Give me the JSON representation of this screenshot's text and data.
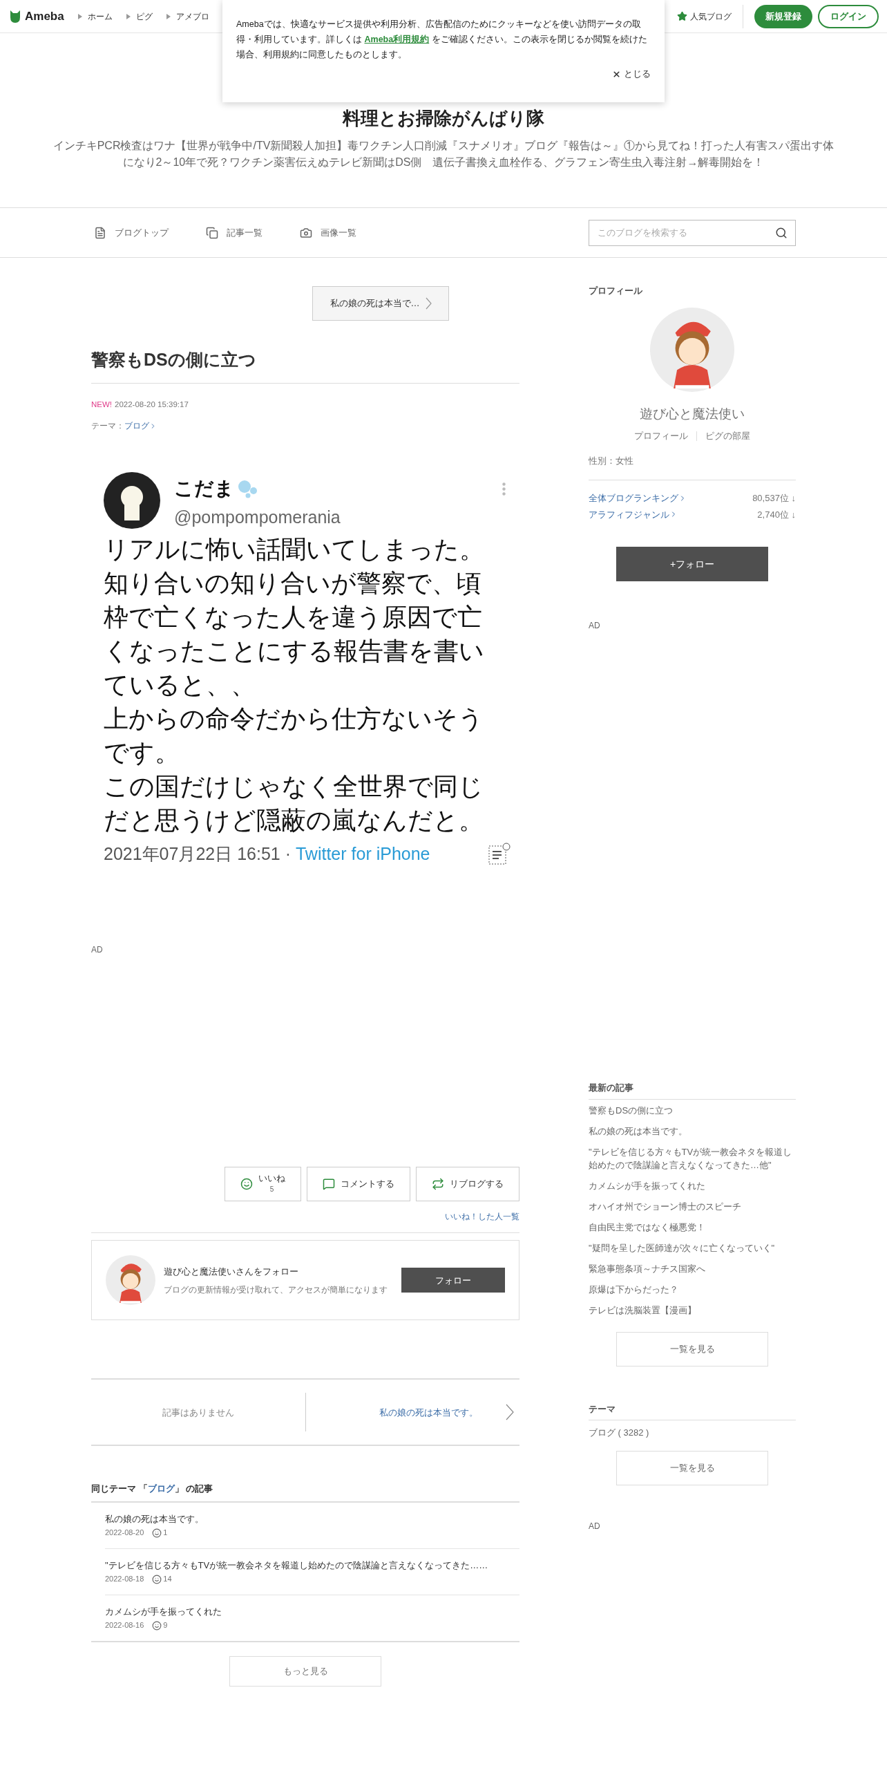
{
  "header": {
    "logo": "Ameba",
    "nav": [
      "ホーム",
      "ピグ",
      "アメブロ"
    ],
    "popular": "人気ブログ",
    "signup": "新規登録",
    "login": "ログイン"
  },
  "cookie_banner": {
    "text_before": "Amebaでは、快適なサービス提供や利用分析、広告配信のためにクッキーなどを使い訪問データの取得・利用しています。詳しくは ",
    "link": "Ameba利用規約",
    "text_after": " をご確認ください。この表示を閉じるか閲覧を続けた場合、利用規約に同意したものとします。",
    "close": "とじる"
  },
  "blog": {
    "title": "料理とお掃除がんばり隊",
    "description": "インチキPCR検査はワナ【世界が戦争中/TV新聞殺人加担】毒ワクチン人口削減『スナメリオ』ブログ『報告は～』①から見てね！打った人有害スパ蛋出す体になり2～10年で死？ワクチン薬害伝えぬテレビ新聞はDS側　遺伝子書換え血栓作る、グラフェン寄生虫入毒注射→解毒開始を！"
  },
  "blog_nav": [
    {
      "kind": "doc",
      "label": "ブログトップ"
    },
    {
      "kind": "pages",
      "label": "記事一覧"
    },
    {
      "kind": "camera",
      "label": "画像一覧"
    }
  ],
  "search": {
    "placeholder": "このブログを検索する"
  },
  "article": {
    "prev_link": "私の娘の死は本当で…",
    "title": "警察もDSの側に立つ",
    "new_badge": "NEW!",
    "date": "2022-08-20 15:39:17",
    "theme_label": "テーマ：",
    "theme": "ブログ",
    "tweet": {
      "name": "こだま",
      "handle": "@pompompomerania",
      "lines": [
        "リアルに怖い話聞いてしまった。",
        "知り合いの知り合いが警察で、頃枠で亡くなった人を違う原因で亡くなったことにする報告書を書いていると、、",
        "上からの命令だから仕方ないそうです。",
        "この国だけじゃなく全世界で同じだと思うけど隠蔽の嵐なんだと。"
      ],
      "date": "2021年07月22日 16:51 · ",
      "source": "Twitter for iPhone"
    },
    "ad": "AD",
    "actions": [
      {
        "kind": "like",
        "label": "いいね",
        "count": "5"
      },
      {
        "kind": "comment",
        "label": "コメントする"
      },
      {
        "kind": "reblog",
        "label": "リブログする"
      }
    ],
    "likers_link": "いいね！した人一覧",
    "follow_card": {
      "title": "遊び心と魔法使いさんをフォロー",
      "subtitle": "ブログの更新情報が受け取れて、アクセスが簡単になります",
      "button": "フォロー"
    },
    "pager": {
      "prev": "記事はありません",
      "next": "私の娘の死は本当です。"
    },
    "same_theme": {
      "prefix": "同じテーマ 「",
      "theme": "ブログ",
      "suffix": "」 の記事",
      "items": [
        {
          "title": "私の娘の死は本当です。",
          "date": "2022-08-20",
          "likes": "1"
        },
        {
          "title": "\"テレビを信じる方々もTVが統一教会ネタを報道し始めたので陰謀論と言えなくなってきた……",
          "date": "2022-08-18",
          "likes": "14"
        },
        {
          "title": "カメムシが手を振ってくれた",
          "date": "2022-08-16",
          "likes": "9"
        }
      ],
      "more": "もっと見る"
    }
  },
  "sidebar": {
    "profile_heading": "プロフィール",
    "name": "遊び心と魔法使い",
    "links": [
      "プロフィール",
      "ピグの部屋"
    ],
    "gender": "性別：女性",
    "rankings": [
      {
        "label": "全体ブログランキング",
        "value": "80,537位 ↓"
      },
      {
        "label": "アラフィフジャンル",
        "value": "2,740位 ↓"
      }
    ],
    "follow_button": "+フォロー",
    "ad_top": "AD",
    "latest_heading": "最新の記事",
    "latest": [
      "警察もDSの側に立つ",
      "私の娘の死は本当です。",
      "\"テレビを信じる方々もTVが統一教会ネタを報道し始めたので陰謀論と言えなくなってきた…他\"",
      "カメムシが手を振ってくれた",
      "オハイオ州でショーン博士のスピーチ",
      "自由民主党ではなく極悪党！",
      "\"疑問を呈した医師達が次々に亡くなっていく\"",
      "緊急事態条項～ナチス国家へ",
      "原爆は下からだった？",
      "テレビは洗脳装置【漫画】"
    ],
    "latest_more": "一覧を見る",
    "theme_heading": "テーマ",
    "themes": [
      "ブログ ( 3282 )"
    ],
    "theme_more": "一覧を見る",
    "ad_bottom": "AD"
  }
}
